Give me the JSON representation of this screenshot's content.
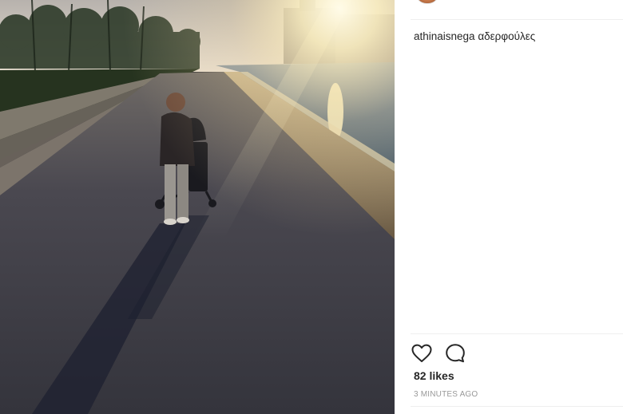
{
  "photo": {
    "alt": "",
    "colors": {
      "sky": "#c9c6c2",
      "sun": "#fff6d6",
      "water": "#5d6f80",
      "path": "#3d3d44",
      "grass": "#23301f"
    }
  },
  "post": {
    "caption_user": "athinaisnega",
    "caption_text": "αδερφούλες",
    "likes_text": "82 likes",
    "timestamp": "3 MINUTES AGO"
  },
  "icons": {
    "like": "heart-icon",
    "comment": "comment-icon"
  },
  "colors": {
    "text": "#262626",
    "muted": "#999999",
    "divider": "#efefef"
  }
}
